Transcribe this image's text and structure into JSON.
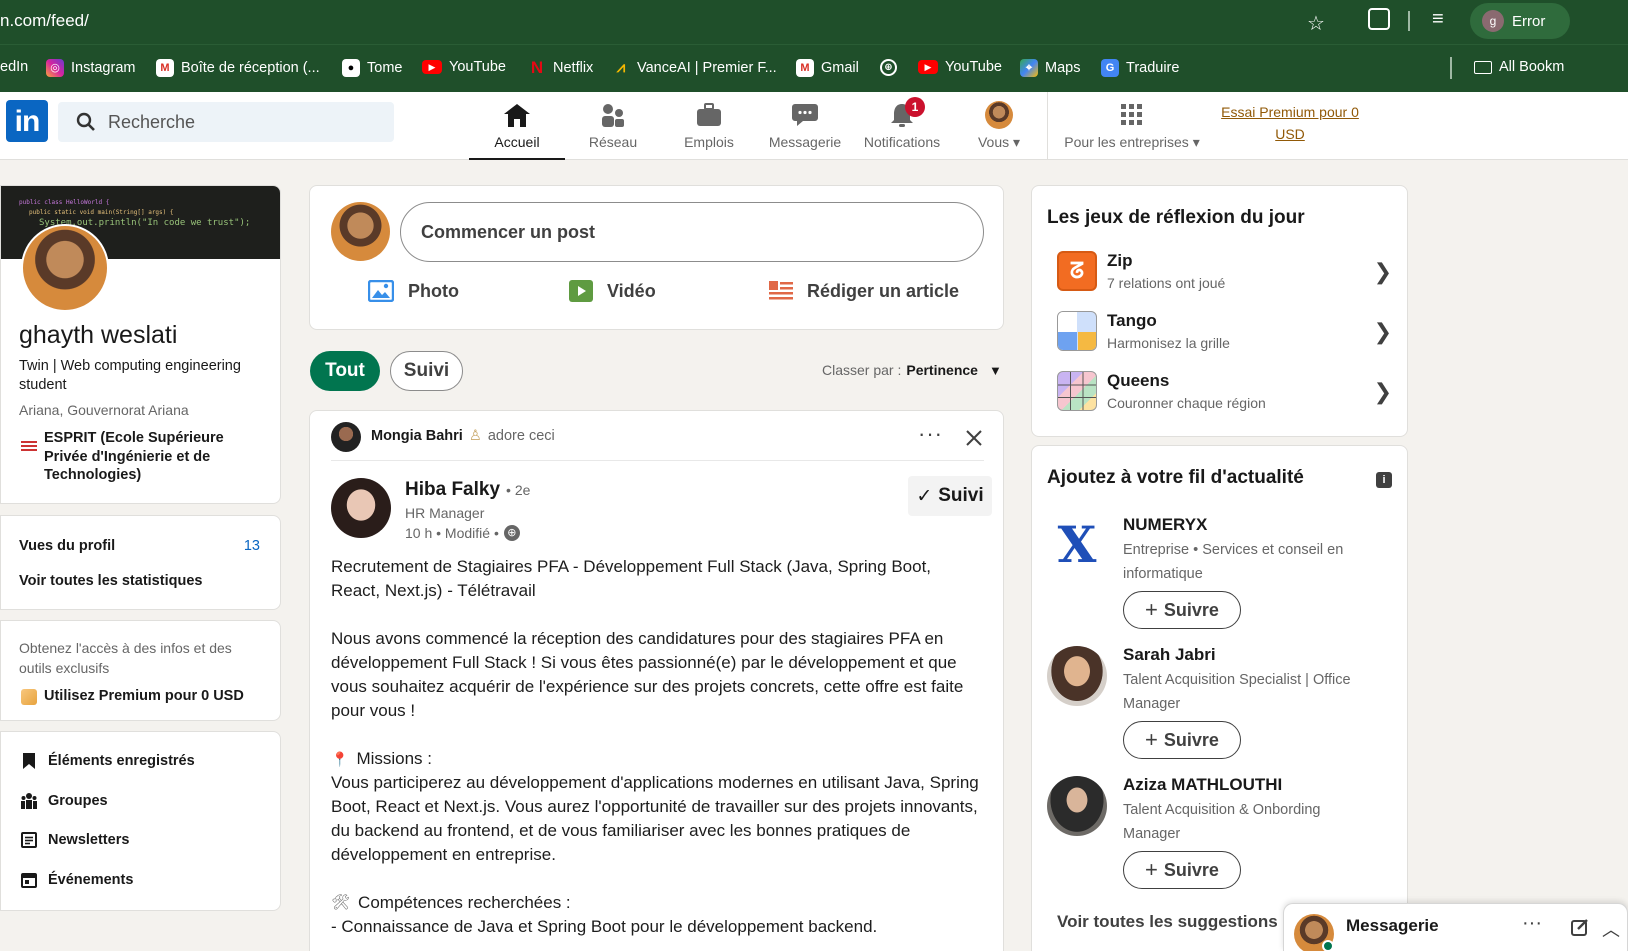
{
  "browser": {
    "url": "n.com/feed/",
    "profile_label": "Error",
    "profile_initial": "g",
    "bookmarks": [
      {
        "label": "edIn"
      },
      {
        "label": "Instagram"
      },
      {
        "label": "Boîte de réception (..."
      },
      {
        "label": "Tome"
      },
      {
        "label": "YouTube"
      },
      {
        "label": "Netflix"
      },
      {
        "label": "VanceAI | Premier F..."
      },
      {
        "label": "Gmail"
      },
      {
        "label": "YouTube"
      },
      {
        "label": "Maps"
      },
      {
        "label": "Traduire"
      }
    ],
    "all_bookmarks": "All Bookm"
  },
  "header": {
    "logo": "in",
    "search_placeholder": "Recherche",
    "nav": [
      {
        "label": "Accueil"
      },
      {
        "label": "Réseau"
      },
      {
        "label": "Emplois"
      },
      {
        "label": "Messagerie"
      },
      {
        "label": "Notifications"
      },
      {
        "label": "Vous"
      },
      {
        "label": "Pour les entreprises"
      }
    ],
    "notification_count": "1",
    "premium_line1": "Essai Premium pour 0",
    "premium_line2": "USD"
  },
  "profile": {
    "banner_code_1": "public class HelloWorld {",
    "banner_code_2": "public static void main(String[] args) {",
    "banner_code_3": "System.out.println(\"In code we trust\");",
    "name": "ghayth weslati",
    "headline": "Twin | Web computing engineering student",
    "location": "Ariana, Gouvernorat Ariana",
    "school": "ESPRIT (Ecole Supérieure Privée d'Ingénierie et de Technologies)",
    "views_label": "Vues du profil",
    "views_count": "13",
    "stats_link": "Voir toutes les statistiques",
    "premium_text": "Obtenez l'accès à des infos et des outils exclusifs",
    "premium_cta": "Utilisez Premium pour 0 USD",
    "links": [
      {
        "label": "Éléments enregistrés"
      },
      {
        "label": "Groupes"
      },
      {
        "label": "Newsletters"
      },
      {
        "label": "Événements"
      }
    ]
  },
  "composer": {
    "placeholder": "Commencer un post",
    "photo": "Photo",
    "video": "Vidéo",
    "article": "Rédiger un article"
  },
  "filters": {
    "all": "Tout",
    "followed": "Suivi",
    "sort_label": "Classer par :",
    "sort_value": "Pertinence"
  },
  "post": {
    "reactor_name": "Mongia Bahri",
    "reaction": "adore ceci",
    "author": "Hiba Falky",
    "degree": "• 2e",
    "title": "HR Manager",
    "time": "10 h • Modifié •",
    "follow_state": "Suivi",
    "para1": "Recrutement de Stagiaires PFA - Développement Full Stack (Java, Spring Boot, React, Next.js) - Télétravail",
    "para2": "Nous avons commencé la réception des candidatures pour des stagiaires PFA en développement Full Stack ! Si vous êtes passionné(e) par le développement et que vous souhaitez acquérir de l'expérience sur des projets concrets, cette offre est faite pour vous !",
    "missions_title": "Missions :",
    "missions_text": "Vous participerez au développement d'applications modernes en utilisant Java, Spring Boot, React et Next.js. Vous aurez l'opportunité de travailler sur des projets innovants, du backend au frontend, et de vous familiariser avec les bonnes pratiques de développement en entreprise.",
    "skills_title": "Compétences recherchées :",
    "skills_item1": "- Connaissance de Java et Spring Boot pour le développement backend."
  },
  "games": {
    "title": "Les jeux de réflexion du jour",
    "items": [
      {
        "name": "Zip",
        "subtitle": "7 relations ont joué"
      },
      {
        "name": "Tango",
        "subtitle": "Harmonisez la grille"
      },
      {
        "name": "Queens",
        "subtitle": "Couronner chaque région"
      }
    ]
  },
  "suggestions": {
    "title": "Ajoutez à votre fil d'actualité",
    "follow_label": "Suivre",
    "items": [
      {
        "name": "NUMERYX",
        "desc": "Entreprise • Services et conseil en informatique"
      },
      {
        "name": "Sarah Jabri",
        "desc": "Talent Acquisition Specialist | Office Manager"
      },
      {
        "name": "Aziza MATHLOUTHI",
        "desc": "Talent Acquisition & Onbording Manager"
      }
    ],
    "see_all": "Voir toutes les suggestions"
  },
  "messaging": {
    "label": "Messagerie"
  },
  "colors": {
    "linkedin_blue": "#0a66c2",
    "active_green": "#01754f",
    "browser_green": "#1f4f2a",
    "notification_red": "#cb112d"
  }
}
